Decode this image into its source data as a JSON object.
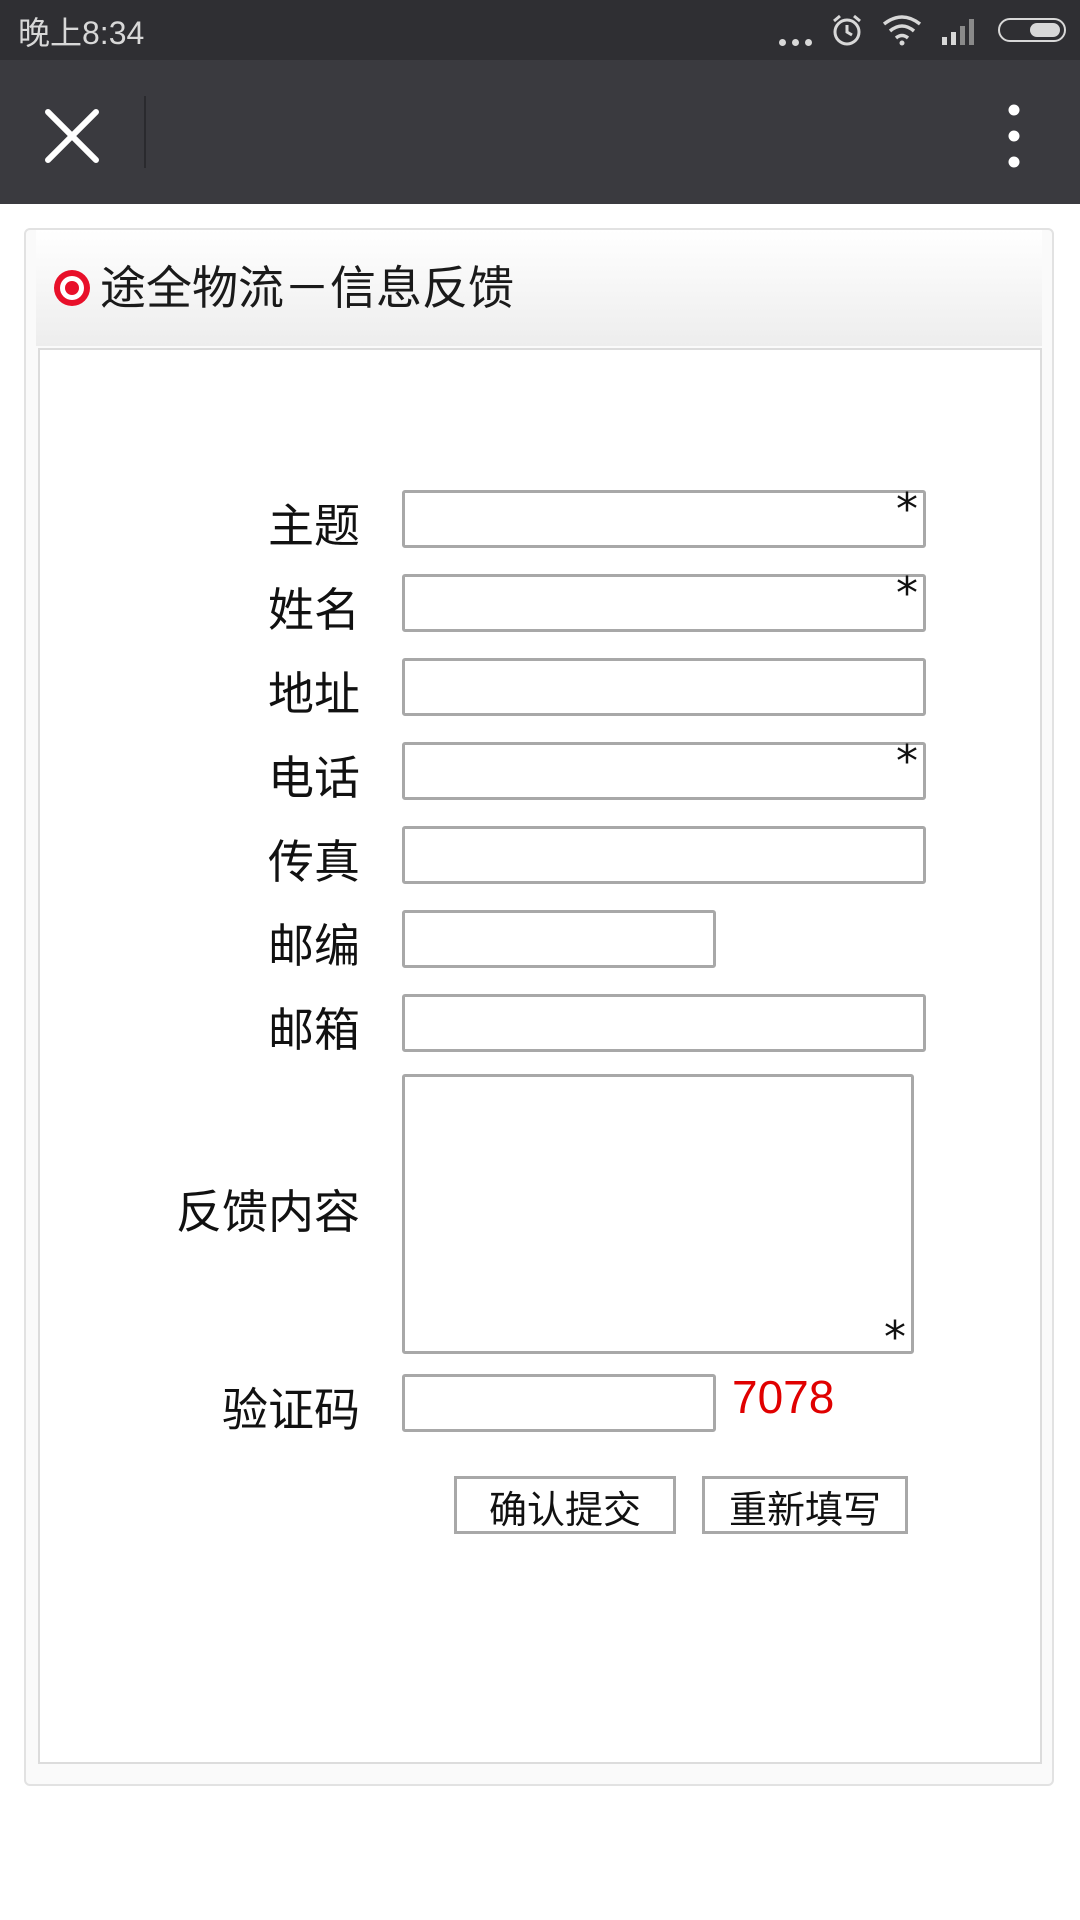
{
  "status_bar": {
    "time": "晚上8:34"
  },
  "nav": {
    "close_icon": "close-icon",
    "more_icon": "more-vertical-icon"
  },
  "form": {
    "title": "途全物流－信息反馈",
    "required_mark": "*",
    "fields": {
      "subject_label": "主题",
      "name_label": "姓名",
      "address_label": "地址",
      "phone_label": "电话",
      "fax_label": "传真",
      "postcode_label": "邮编",
      "email_label": "邮箱",
      "content_label": "反馈内容",
      "captcha_label": "验证码"
    },
    "captcha_code": "7078",
    "submit_label": "确认提交",
    "reset_label": "重新填写"
  },
  "colors": {
    "captcha": "#e00000",
    "title_icon": "#e8102a"
  }
}
